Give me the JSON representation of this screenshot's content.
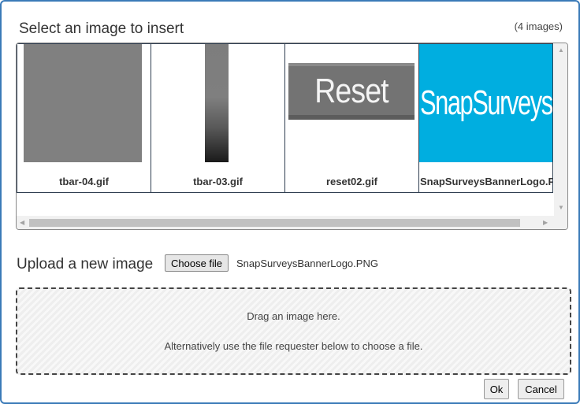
{
  "dialog": {
    "title": "Select an image to insert",
    "image_count": "(4 images)"
  },
  "gallery": {
    "items": [
      {
        "filename": "tbar-04.gif"
      },
      {
        "filename": "tbar-03.gif"
      },
      {
        "filename": "reset02.gif",
        "image_text": "Reset"
      },
      {
        "filename": "SnapSurveysBannerLogo.PNG",
        "image_text": "SnapSurveys"
      }
    ]
  },
  "upload": {
    "label": "Upload a new image",
    "choose_button": "Choose file",
    "selected_file": "SnapSurveysBannerLogo.PNG"
  },
  "dropzone": {
    "line1": "Drag an image here.",
    "line2": "Alternatively use the file requester below to choose a file."
  },
  "buttons": {
    "ok": "Ok",
    "cancel": "Cancel"
  },
  "colors": {
    "dialog_border": "#3a7ab8",
    "logo_background": "#00aee0"
  }
}
